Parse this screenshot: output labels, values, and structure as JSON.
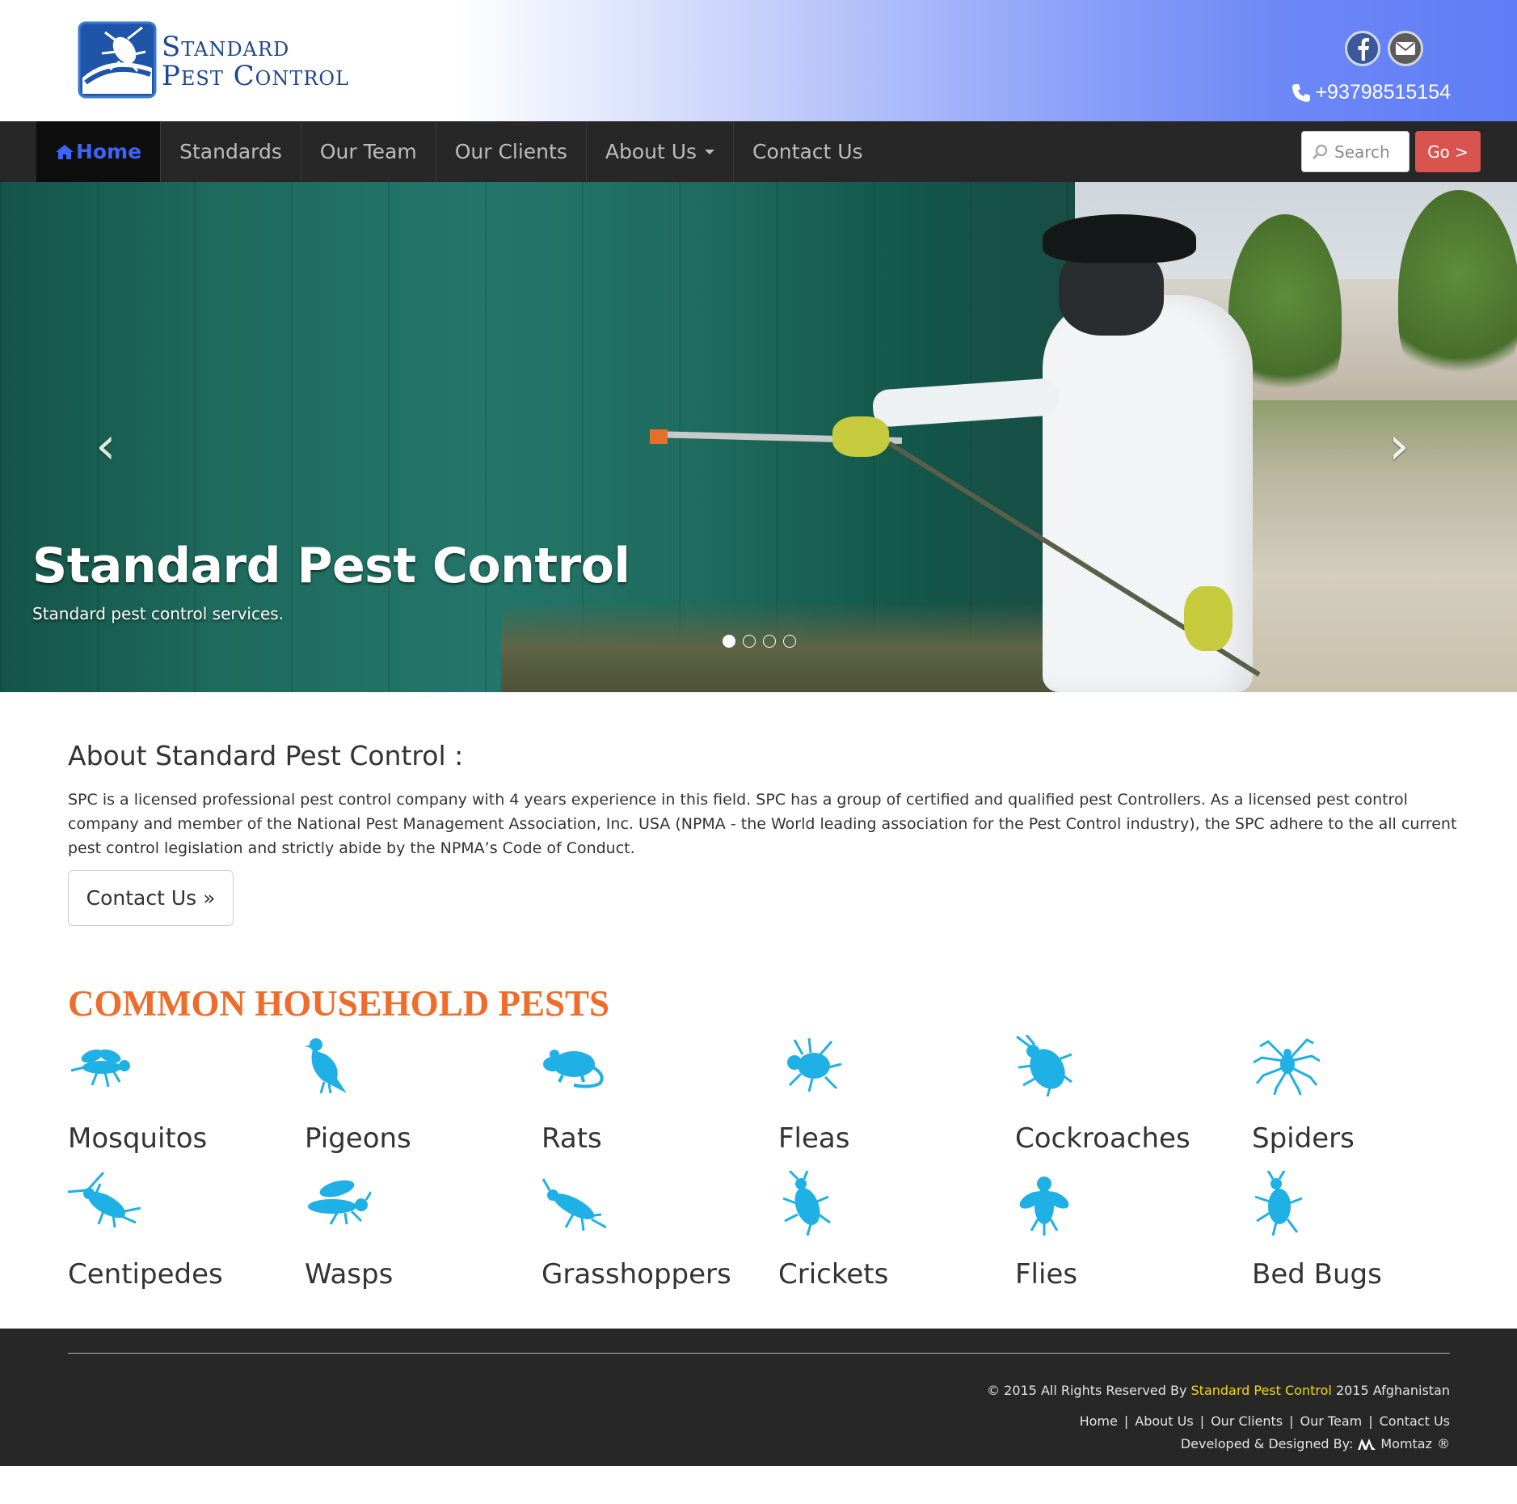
{
  "header": {
    "logo_line1": "Standard",
    "logo_line2": "Pest Control",
    "phone": "+93798515154",
    "social_icons": [
      "facebook-icon",
      "mail-icon"
    ]
  },
  "nav": {
    "items": [
      {
        "label": "Home",
        "icon": "home-icon",
        "active": true
      },
      {
        "label": "Standards"
      },
      {
        "label": "Our Team"
      },
      {
        "label": "Our Clients"
      },
      {
        "label": "About Us",
        "dropdown": true
      },
      {
        "label": "Contact Us"
      }
    ],
    "search_placeholder": "Search",
    "go_label": "Go >"
  },
  "hero": {
    "title": "Standard Pest Control",
    "subtitle": "Standard pest control services.",
    "slide_count": 4,
    "active_slide": 1
  },
  "about": {
    "heading": "About Standard Pest Control :",
    "body": "SPC is a licensed professional pest control company with 4 years experience in this field. SPC has a group of certified and qualified pest Controllers. As a licensed pest control company and member of the National Pest Management Association, Inc. USA (NPMA - the World leading association for the Pest Control industry), the SPC adhere to the all current pest control legislation and strictly abide by the NPMA’s Code of Conduct.",
    "button": "Contact Us »"
  },
  "pests": {
    "title": "COMMON HOUSEHOLD PESTS",
    "icon_color": "#1fb0e6",
    "items": [
      {
        "label": "Mosquitos",
        "icon": "mosquito-icon"
      },
      {
        "label": "Pigeons",
        "icon": "pigeon-icon"
      },
      {
        "label": "Rats",
        "icon": "rat-icon"
      },
      {
        "label": "Fleas",
        "icon": "flea-icon"
      },
      {
        "label": "Cockroaches",
        "icon": "cockroach-icon"
      },
      {
        "label": "Spiders",
        "icon": "spider-icon"
      },
      {
        "label": "Centipedes",
        "icon": "centipede-icon"
      },
      {
        "label": "Wasps",
        "icon": "wasp-icon"
      },
      {
        "label": "Grasshoppers",
        "icon": "grasshopper-icon"
      },
      {
        "label": "Crickets",
        "icon": "cricket-icon"
      },
      {
        "label": "Flies",
        "icon": "fly-icon"
      },
      {
        "label": "Bed Bugs",
        "icon": "bed-bug-icon"
      }
    ]
  },
  "footer": {
    "copy_prefix": "© 2015 All Rights Reserved By",
    "copy_brand": "Standard Pest Control",
    "copy_suffix": "2015 Afghanistan",
    "links": [
      "Home",
      "About Us",
      "Our Clients",
      "Our Team",
      "Contact Us"
    ],
    "dev_prefix": "Developed & Designed By:",
    "dev_name": "Momtaz",
    "dev_mark": "®"
  }
}
